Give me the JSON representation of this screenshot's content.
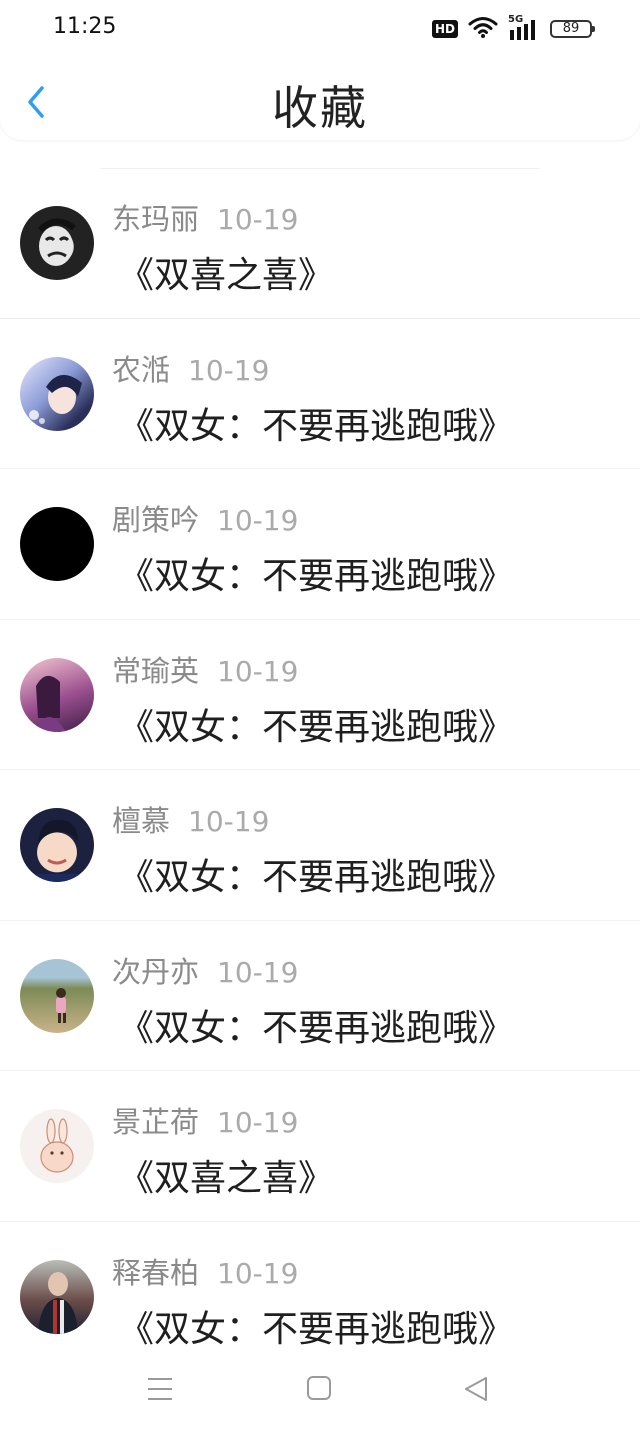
{
  "status_bar": {
    "time": "11:25",
    "hd_label": "HD",
    "network_label": "5G",
    "battery": "89"
  },
  "header": {
    "title": "收藏",
    "back_icon": "chevron-left-icon",
    "accent_color": "#2e9ef0"
  },
  "favorites": [
    {
      "user": "东玛丽",
      "date": "10-19",
      "book": "《双喜之喜》"
    },
    {
      "user": "农湉",
      "date": "10-19",
      "book": "《双女：不要再逃跑哦》"
    },
    {
      "user": "剧策吟",
      "date": "10-19",
      "book": "《双女：不要再逃跑哦》"
    },
    {
      "user": "常瑜英",
      "date": "10-19",
      "book": "《双女：不要再逃跑哦》"
    },
    {
      "user": "檀慕",
      "date": "10-19",
      "book": "《双女：不要再逃跑哦》"
    },
    {
      "user": "次丹亦",
      "date": "10-19",
      "book": "《双女：不要再逃跑哦》"
    },
    {
      "user": "景芷荷",
      "date": "10-19",
      "book": "《双喜之喜》"
    },
    {
      "user": "释春柏",
      "date": "10-19",
      "book": "《双女：不要再逃跑哦》"
    }
  ],
  "bottom_nav": {
    "menu_icon": "menu-icon",
    "home_icon": "home-square-icon",
    "back_icon": "back-triangle-icon"
  }
}
